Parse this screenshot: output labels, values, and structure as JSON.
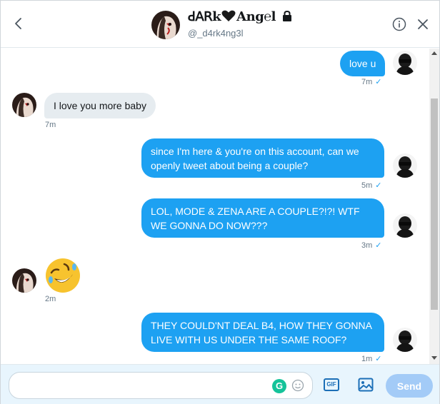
{
  "header": {
    "display_name": "ꓒꓮꓣk",
    "display_name_suffix": "Ang℮l",
    "handle": "@_d4rk4ng3l"
  },
  "messages": [
    {
      "direction": "out",
      "text": "love u",
      "time": "7m",
      "read": "✓"
    },
    {
      "direction": "in",
      "text": "I love you more baby",
      "time": "7m"
    },
    {
      "direction": "out",
      "text": "since I'm here & you're on this account, can we openly tweet about being a couple?",
      "time": "5m",
      "read": "✓"
    },
    {
      "direction": "out",
      "text": "LOL, MODE & ZENA ARE A COUPLE?!?! WTF WE GONNA DO NOW???",
      "time": "3m",
      "read": "✓"
    },
    {
      "direction": "in",
      "emoji": "rolling-on-the-floor-laughing",
      "time": "2m"
    },
    {
      "direction": "out",
      "text": "THEY COULD'NT DEAL B4, HOW THEY GONNA LIVE WITH US UNDER THE SAME ROOF?",
      "time": "1m",
      "read": "✓"
    }
  ],
  "composer": {
    "value": "",
    "gif_label": "GIF",
    "send_label": "Send"
  },
  "colors": {
    "accent": "#1da1f2",
    "incoming_bubble": "#e6ecf0",
    "send_disabled": "#a3cbf7",
    "composer_bg": "#e8f5fd"
  },
  "icons": [
    "back-arrow-icon",
    "lock-icon",
    "info-icon",
    "close-icon",
    "grammarly-icon",
    "emoji-icon",
    "gif-icon",
    "image-icon",
    "heart-icon"
  ]
}
